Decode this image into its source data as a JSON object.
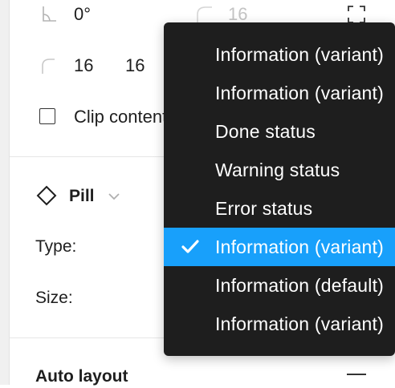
{
  "transform": {
    "rotation_value": "0°",
    "corner_radius_value": "16",
    "corner_tl": "16",
    "corner_tr": "16"
  },
  "clip": {
    "label": "Clip content"
  },
  "component": {
    "name": "Pill",
    "type_label": "Type:",
    "size_label": "Size:"
  },
  "auto_layout": {
    "title": "Auto layout"
  },
  "menu": {
    "items": [
      {
        "label": "Information (variant)",
        "selected": false
      },
      {
        "label": "Information (variant)",
        "selected": false
      },
      {
        "label": "Done status",
        "selected": false
      },
      {
        "label": "Warning status",
        "selected": false
      },
      {
        "label": "Error status",
        "selected": false
      },
      {
        "label": "Information (variant)",
        "selected": true
      },
      {
        "label": "Information (default)",
        "selected": false
      },
      {
        "label": "Information (variant)",
        "selected": false
      }
    ]
  },
  "colors": {
    "menu_background": "#1e1e1e",
    "selected_background": "#18a0fb",
    "text_muted": "#c4c4c4"
  }
}
